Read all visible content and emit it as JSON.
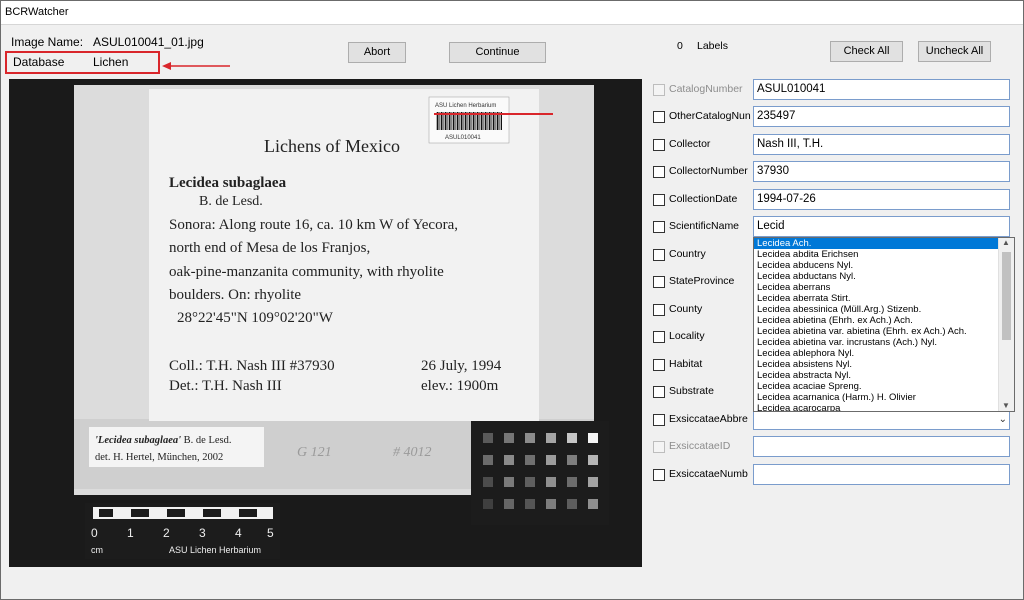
{
  "window": {
    "title": "BCRWatcher"
  },
  "header": {
    "image_name_label": "Image Name:",
    "image_name_value": "ASUL010041_01.jpg",
    "database_label": "Database",
    "database_value": "Lichen",
    "abort_label": "Abort",
    "continue_label": "Continue",
    "labels_count": "0",
    "labels_text": "Labels",
    "check_all_label": "Check All",
    "uncheck_all_label": "Uncheck All"
  },
  "specimen": {
    "barcode_header": "ASU Lichen Herbarium",
    "barcode_number": "ASUL010041",
    "title": "Lichens of Mexico",
    "taxon": "Lecidea subaglaea",
    "author": "B. de Lesd.",
    "locality_lines": [
      "Sonora: Along route 16, ca. 10 km W of Yecora,",
      "north end of Mesa de los Franjos,",
      "oak-pine-manzanita community, with rhyolite",
      "boulders.  On: rhyolite"
    ],
    "coords": "28°22'45\"N   109°02'20\"W",
    "coll": "Coll.: T.H. Nash III #37930",
    "date": "26 July, 1994",
    "det": "Det.: T.H. Nash III",
    "elev": "elev.: 1900m",
    "annotation_taxon": "'Lecidea subaglaea'",
    "annotation_author": " B. de Lesd.",
    "annotation_det": "det. H. Hertel, München, 2002",
    "handwritten_1": "G 121",
    "handwritten_2": "# 4012",
    "scale_numbers": [
      "0",
      "1",
      "2",
      "3",
      "4",
      "5"
    ],
    "scale_unit": "cm",
    "scale_caption": "ASU Lichen Herbarium"
  },
  "fields": [
    {
      "label": "CatalogNumber",
      "value": "ASUL010041",
      "enabled": false
    },
    {
      "label": "OtherCatalogNun",
      "value": "235497",
      "enabled": true
    },
    {
      "label": "Collector",
      "value": "Nash III, T.H.",
      "enabled": true
    },
    {
      "label": "CollectorNumber",
      "value": "37930",
      "enabled": true
    },
    {
      "label": "CollectionDate",
      "value": "1994-07-26",
      "enabled": true
    },
    {
      "label": "ScientificName",
      "value": "Lecid",
      "enabled": true
    },
    {
      "label": "Country",
      "value": "",
      "enabled": true
    },
    {
      "label": "StateProvince",
      "value": "",
      "enabled": true
    },
    {
      "label": "County",
      "value": "",
      "enabled": true
    },
    {
      "label": "Locality",
      "value": "",
      "enabled": true
    },
    {
      "label": "Habitat",
      "value": "",
      "enabled": true
    },
    {
      "label": "Substrate",
      "value": "",
      "enabled": true
    },
    {
      "label": "ExsiccataeAbbre",
      "value": "",
      "enabled": true
    },
    {
      "label": "ExsiccataeID",
      "value": "",
      "enabled": false
    },
    {
      "label": "ExsiccataeNumb",
      "value": "",
      "enabled": true
    }
  ],
  "autocomplete": [
    "Lecidea Ach.",
    "Lecidea abdita Erichsen",
    "Lecidea abducens Nyl.",
    "Lecidea abductans Nyl.",
    "Lecidea aberrans",
    "Lecidea aberrata Stirt.",
    "Lecidea abessinica (Müll.Arg.) Stizenb.",
    "Lecidea abietina (Ehrh. ex Ach.) Ach.",
    "Lecidea abietina var. abietina (Ehrh. ex Ach.) Ach.",
    "Lecidea abietina var. incrustans (Ach.) Nyl.",
    "Lecidea ablephora Nyl.",
    "Lecidea absistens Nyl.",
    "Lecidea abstracta Nyl.",
    "Lecidea acaciae Spreng.",
    "Lecidea acarnanica (Harm.) H. Olivier",
    "Lecidea acarocarpa"
  ],
  "colors": {
    "accent": "#0078d7",
    "highlight": "#d9262b",
    "input_border": "#7a9ccc"
  }
}
